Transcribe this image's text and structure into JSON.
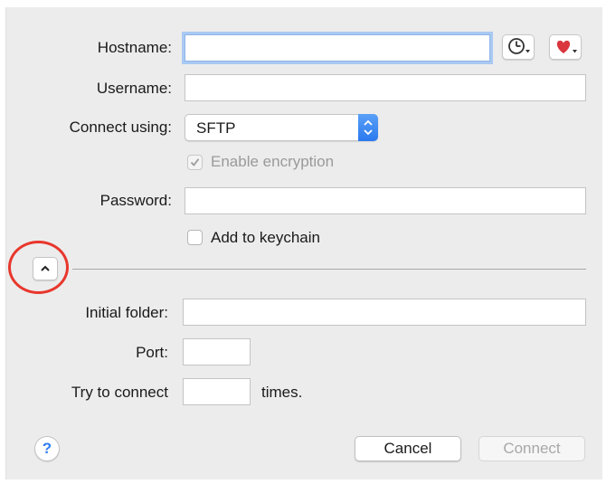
{
  "form": {
    "hostname": {
      "label": "Hostname:",
      "value": ""
    },
    "username": {
      "label": "Username:",
      "value": ""
    },
    "connect_using": {
      "label": "Connect using:",
      "selected": "SFTP"
    },
    "enable_encryption": {
      "label": "Enable encryption",
      "checked": true,
      "enabled": false
    },
    "password": {
      "label": "Password:",
      "value": ""
    },
    "add_to_keychain": {
      "label": "Add to keychain",
      "checked": false
    },
    "initial_folder": {
      "label": "Initial folder:",
      "value": ""
    },
    "port": {
      "label": "Port:",
      "value": ""
    },
    "retry": {
      "label": "Try to connect",
      "suffix": "times.",
      "value": ""
    }
  },
  "icons": {
    "history": "clock-icon",
    "bookmarks": "heart-icon",
    "disclosure": "chevron-up-icon",
    "help": "help-icon",
    "select_stepper": "updown-chevron-icon"
  },
  "help": {
    "label": "?"
  },
  "buttons": {
    "cancel": "Cancel",
    "connect": "Connect"
  },
  "colors": {
    "accent": "#2a79ef",
    "focus_ring": "#a9c9f3",
    "highlight_circle": "#e8372d",
    "heart": "#d9363e"
  }
}
